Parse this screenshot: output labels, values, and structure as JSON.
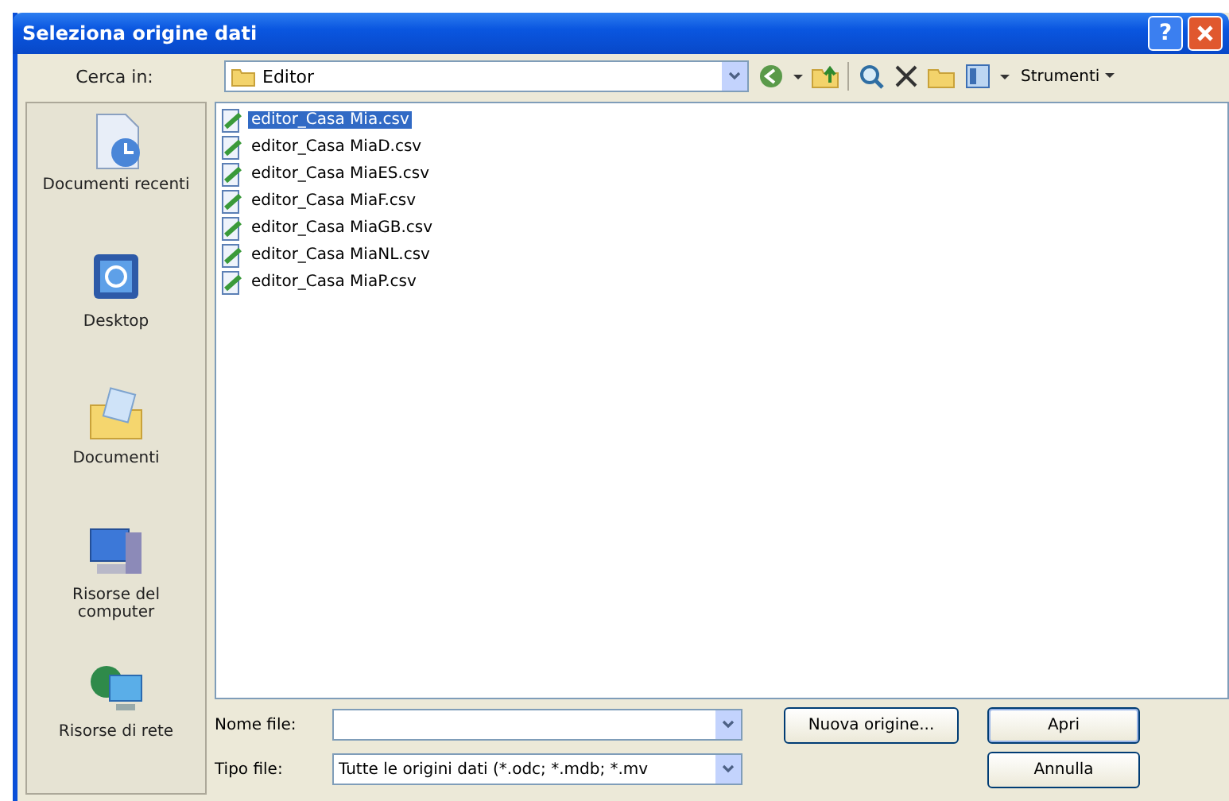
{
  "window": {
    "title": "Seleziona origine dati",
    "help": "?"
  },
  "look_in": {
    "label": "Cerca in:",
    "value": "Editor"
  },
  "toolbar": {
    "tools_label": "Strumenti"
  },
  "places": [
    {
      "label": "Documenti recenti",
      "kind": "recent"
    },
    {
      "label": "Desktop",
      "kind": "desktop"
    },
    {
      "label": "Documenti",
      "kind": "documents"
    },
    {
      "label": "Risorse del computer",
      "kind": "computer"
    },
    {
      "label": "Risorse di rete",
      "kind": "network"
    }
  ],
  "files": [
    {
      "name": "editor_Casa Mia.csv",
      "selected": true
    },
    {
      "name": "editor_Casa MiaD.csv",
      "selected": false
    },
    {
      "name": "editor_Casa MiaES.csv",
      "selected": false
    },
    {
      "name": "editor_Casa MiaF.csv",
      "selected": false
    },
    {
      "name": "editor_Casa MiaGB.csv",
      "selected": false
    },
    {
      "name": "editor_Casa MiaNL.csv",
      "selected": false
    },
    {
      "name": "editor_Casa MiaP.csv",
      "selected": false
    }
  ],
  "file_name": {
    "label": "Nome file:"
  },
  "file_type": {
    "label": "Tipo file:",
    "value": "Tutte le origini dati (*.odc; *.mdb; *.mv"
  },
  "buttons": {
    "new_source": "Nuova origine...",
    "open": "Apri",
    "cancel": "Annulla"
  }
}
